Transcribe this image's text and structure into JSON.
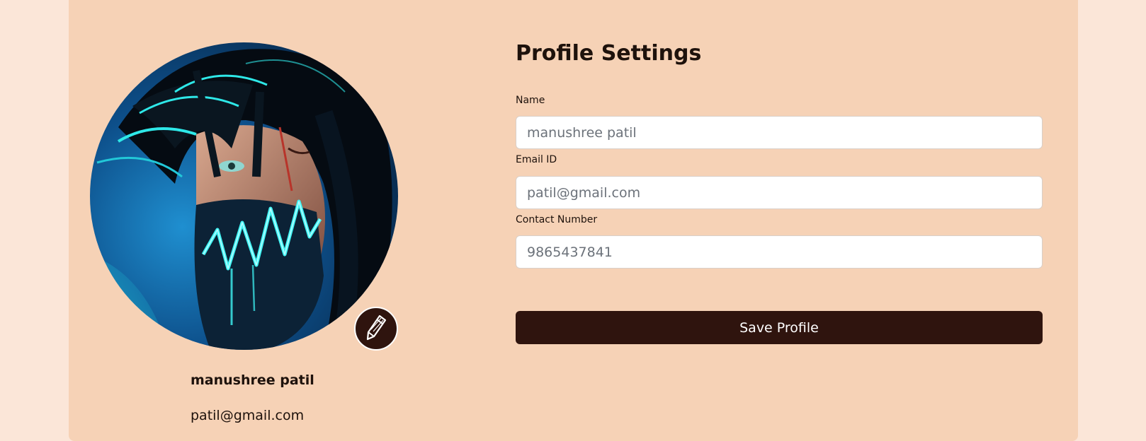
{
  "profile_card": {
    "avatar_alt": "profile avatar",
    "display_name": "manushree patil",
    "display_email": "patil@gmail.com"
  },
  "form": {
    "title": "Profile Settings",
    "name": {
      "label": "Name",
      "placeholder": "manushree patil",
      "value": ""
    },
    "email": {
      "label": "Email ID",
      "placeholder": "patil@gmail.com",
      "value": ""
    },
    "contact": {
      "label": "Contact Number",
      "placeholder": "9865437841",
      "value": ""
    },
    "save_label": "Save Profile"
  },
  "colors": {
    "page_background": "#fbe6d8",
    "card_background": "#f6d2b6",
    "primary_dark": "#2f140e",
    "text": "#1e120c"
  },
  "icons": {
    "edit": "pencil-icon"
  }
}
